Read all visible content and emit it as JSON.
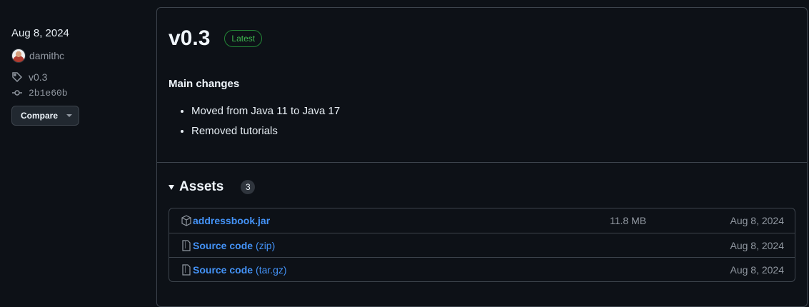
{
  "release": {
    "date": "Aug 8, 2024",
    "author": "damithc",
    "tag": "v0.3",
    "commit": "2b1e60b",
    "compare_label": "Compare",
    "title": "v0.3",
    "badge": "Latest",
    "notes": {
      "heading": "Main changes",
      "items": [
        "Moved from Java 11 to Java 17",
        "Removed tutorials"
      ]
    },
    "assets": {
      "title": "Assets",
      "count": "3",
      "items": [
        {
          "name": "addressbook.jar",
          "suffix": "",
          "size": "11.8 MB",
          "date": "Aug 8, 2024",
          "icon": "package-icon"
        },
        {
          "name": "Source code",
          "suffix": "(zip)",
          "size": "",
          "date": "Aug 8, 2024",
          "icon": "file-zip-icon"
        },
        {
          "name": "Source code",
          "suffix": "(tar.gz)",
          "size": "",
          "date": "Aug 8, 2024",
          "icon": "file-zip-icon"
        }
      ]
    }
  },
  "colors": {
    "background": "#0d1117",
    "link": "#4493f8",
    "badge_green": "#3fb950",
    "border": "#3d444d"
  }
}
